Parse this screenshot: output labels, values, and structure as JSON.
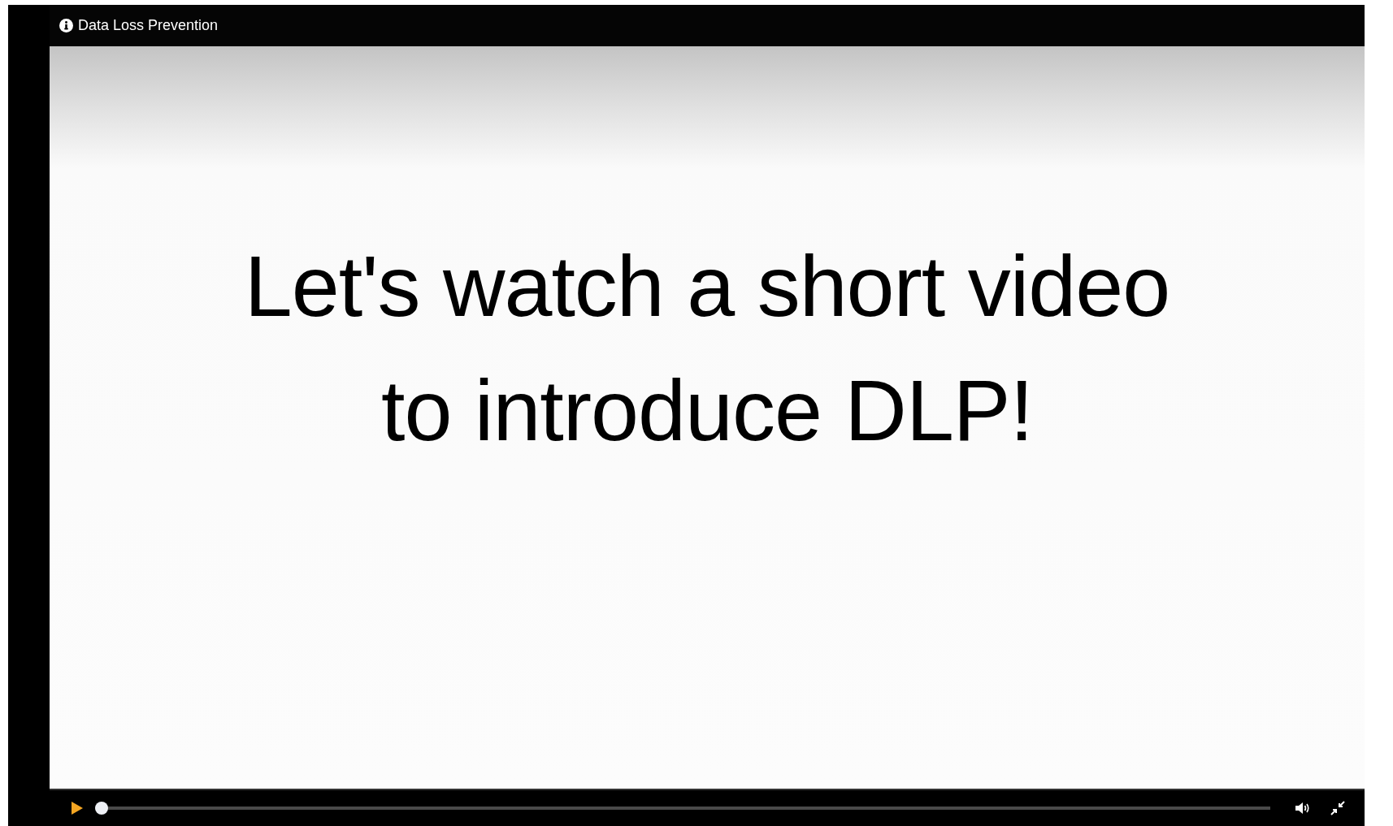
{
  "player": {
    "title": "Data Loss Prevention"
  },
  "slide": {
    "heading_lines": [
      "Let's watch a short video",
      "to introduce DLP!"
    ]
  },
  "controls": {
    "playing": false,
    "progress": {
      "level": 0
    }
  }
}
